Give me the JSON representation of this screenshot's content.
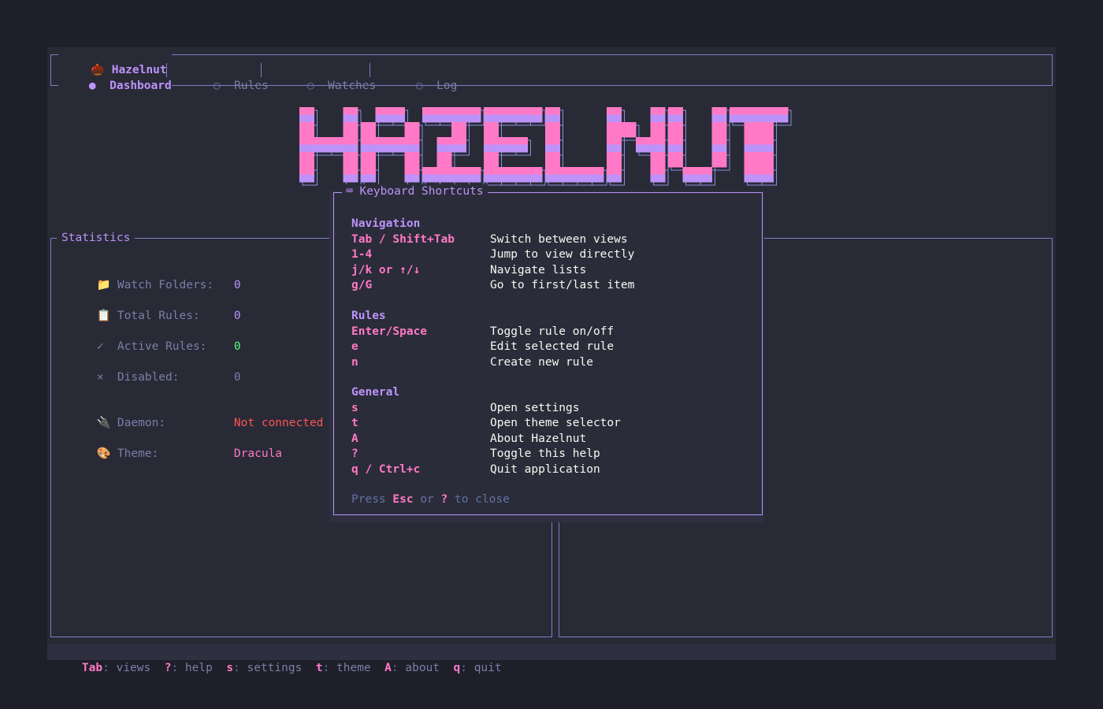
{
  "app": {
    "icon": "acorn-icon",
    "glyph": "🌰",
    "title": "Hazelnut"
  },
  "tabs": [
    {
      "bullet": "●",
      "label": "Dashboard",
      "active": true
    },
    {
      "bullet": "○",
      "label": "Rules",
      "active": false
    },
    {
      "bullet": "○",
      "label": "Watches",
      "active": false
    },
    {
      "bullet": "○",
      "label": "Log",
      "active": false
    }
  ],
  "logo": {
    "text": "HAZELNUT",
    "colors": [
      "#ff79c6",
      "#bd93f9"
    ]
  },
  "statistics": {
    "title": "Statistics",
    "rows": [
      {
        "icon": "folder-icon",
        "glyph": "📁",
        "label": "Watch Folders:",
        "value": "0",
        "value_color": "#bd93f9"
      },
      {
        "icon": "clipboard-icon",
        "glyph": "📋",
        "label": "Total Rules:",
        "value": "0",
        "value_color": "#bd93f9"
      },
      {
        "icon": "check-icon",
        "glyph": "✓",
        "label": "Active Rules:",
        "value": "0",
        "value_color": "#50fa7b"
      },
      {
        "icon": "cross-icon",
        "glyph": "×",
        "label": "Disabled:",
        "value": "0",
        "value_color": "#7a7fa8"
      },
      {
        "icon": "plug-icon",
        "glyph": "🔌",
        "label": "Daemon:",
        "value": "Not connected",
        "value_color": "#ff5555"
      },
      {
        "icon": "palette-icon",
        "glyph": "🎨",
        "label": "Theme:",
        "value": "Dracula",
        "value_color": "#ff79c6"
      }
    ]
  },
  "help": {
    "title_icon": "keyboard-icon",
    "title_glyph": "⌨",
    "title": "Keyboard Shortcuts",
    "sections": [
      {
        "heading": "Navigation",
        "items": [
          {
            "key": "Tab / Shift+Tab",
            "desc": "Switch between views"
          },
          {
            "key": "1-4",
            "desc": "Jump to view directly"
          },
          {
            "key": "j/k or ↑/↓",
            "desc": "Navigate lists"
          },
          {
            "key": "g/G",
            "desc": "Go to first/last item"
          }
        ]
      },
      {
        "heading": "Rules",
        "items": [
          {
            "key": "Enter/Space",
            "desc": "Toggle rule on/off"
          },
          {
            "key": "e",
            "desc": "Edit selected rule"
          },
          {
            "key": "n",
            "desc": "Create new rule"
          }
        ]
      },
      {
        "heading": "General",
        "items": [
          {
            "key": "s",
            "desc": "Open settings"
          },
          {
            "key": "t",
            "desc": "Open theme selector"
          },
          {
            "key": "A",
            "desc": "About Hazelnut"
          },
          {
            "key": "?",
            "desc": "Toggle this help"
          },
          {
            "key": "q / Ctrl+c",
            "desc": "Quit application"
          }
        ]
      }
    ],
    "footer": {
      "pre": "Press ",
      "key1": "Esc",
      "mid": " or ",
      "key2": "?",
      "post": " to close"
    }
  },
  "statusbar": [
    {
      "key": "Tab",
      "label": "views"
    },
    {
      "key": "?",
      "label": "help"
    },
    {
      "key": "s",
      "label": "settings"
    },
    {
      "key": "t",
      "label": "theme"
    },
    {
      "key": "A",
      "label": "about"
    },
    {
      "key": "q",
      "label": "quit"
    }
  ],
  "colors": {
    "background": "#282a36",
    "accent": "#bd93f9",
    "pink": "#ff79c6",
    "border": "#7b7fc4",
    "muted": "#6272a4"
  }
}
